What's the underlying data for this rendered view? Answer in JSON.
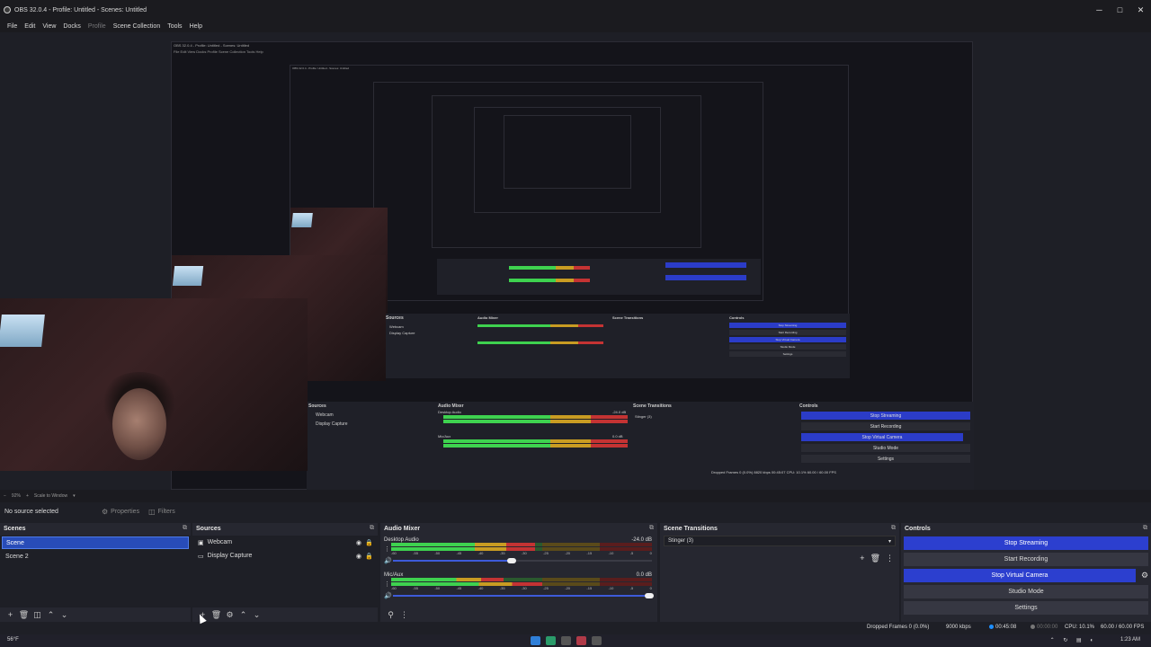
{
  "window": {
    "title": "OBS 32.0.4 - Profile: Untitled - Scenes: Untitled",
    "controls": [
      "─",
      "□",
      "✕"
    ]
  },
  "menu": [
    "File",
    "Edit",
    "View",
    "Docks",
    "Profile",
    "Scene Collection",
    "Tools",
    "Help"
  ],
  "nested_preview": {
    "title": "OBS 32.0.4 - Profile: Untitled - Scenes: Untitled",
    "menu": "File   Edit   View   Docks   Profile   Scene Collection   Tools   Help",
    "sources_header": "Sources",
    "sources": [
      "Webcam",
      "Display Capture"
    ],
    "mixer_header": "Audio Mixer",
    "mixer_channels": [
      {
        "name": "Desktop Audio",
        "db": "-24.0 dB"
      },
      {
        "name": "Mic/Aux",
        "db": "0.0 dB"
      }
    ],
    "transitions_header": "Scene Transitions",
    "transition": "Stinger (3)",
    "controls_header": "Controls",
    "controls": [
      "Stop Streaming",
      "Start Recording",
      "Stop Virtual Camera",
      "Studio Mode",
      "Settings"
    ],
    "status": "Dropped Frames 0 (0.0%)   8820 kbps   00:45:07   CPU: 10.1%   60.00 / 60.00 FPS"
  },
  "zoom": {
    "percent": "92%",
    "scale_label": "Scale to Window"
  },
  "source_toolbar": {
    "no_source": "No source selected",
    "properties": "Properties",
    "filters": "Filters"
  },
  "scenes": {
    "header": "Scenes",
    "items": [
      {
        "label": "Scene",
        "selected": true
      },
      {
        "label": "Scene 2",
        "selected": false
      }
    ]
  },
  "sources": {
    "header": "Sources",
    "items": [
      {
        "label": "Webcam",
        "icon": "camera-icon"
      },
      {
        "label": "Display Capture",
        "icon": "monitor-icon"
      }
    ]
  },
  "mixer": {
    "header": "Audio Mixer",
    "ticks": [
      "-60",
      "-55",
      "-50",
      "-45",
      "-40",
      "-35",
      "-30",
      "-25",
      "-20",
      "-15",
      "-10",
      "-5",
      "0"
    ],
    "channels": [
      {
        "name": "Desktop Audio",
        "db": "-24.0 dB",
        "volume": 0.47,
        "level1": 0.55,
        "level2": 0.55
      },
      {
        "name": "Mic/Aux",
        "db": "0.0 dB",
        "volume": 1.0,
        "level1": 0.43,
        "level2": 0.58
      }
    ]
  },
  "transitions": {
    "header": "Scene Transitions",
    "selected": "Stinger (3)"
  },
  "controls": {
    "header": "Controls",
    "stop_streaming": "Stop Streaming",
    "start_recording": "Start Recording",
    "stop_virtual_camera": "Stop Virtual Camera",
    "studio_mode": "Studio Mode",
    "settings": "Settings"
  },
  "status": {
    "dropped": "Dropped Frames 0 (0.0%)",
    "kbps": "9000 kbps",
    "live_time": "00:45:08",
    "rec_time": "00:00:00",
    "cpu": "CPU: 10.1%",
    "fps": "60.00 / 60.00 FPS"
  },
  "taskbar": {
    "weather": "56°F",
    "clock": "1:23 AM"
  },
  "colors": {
    "accent_blue": "#2c3fcf",
    "meter_green": "#3ed24f",
    "meter_yellow": "#c99c22",
    "meter_red": "#c43333"
  }
}
